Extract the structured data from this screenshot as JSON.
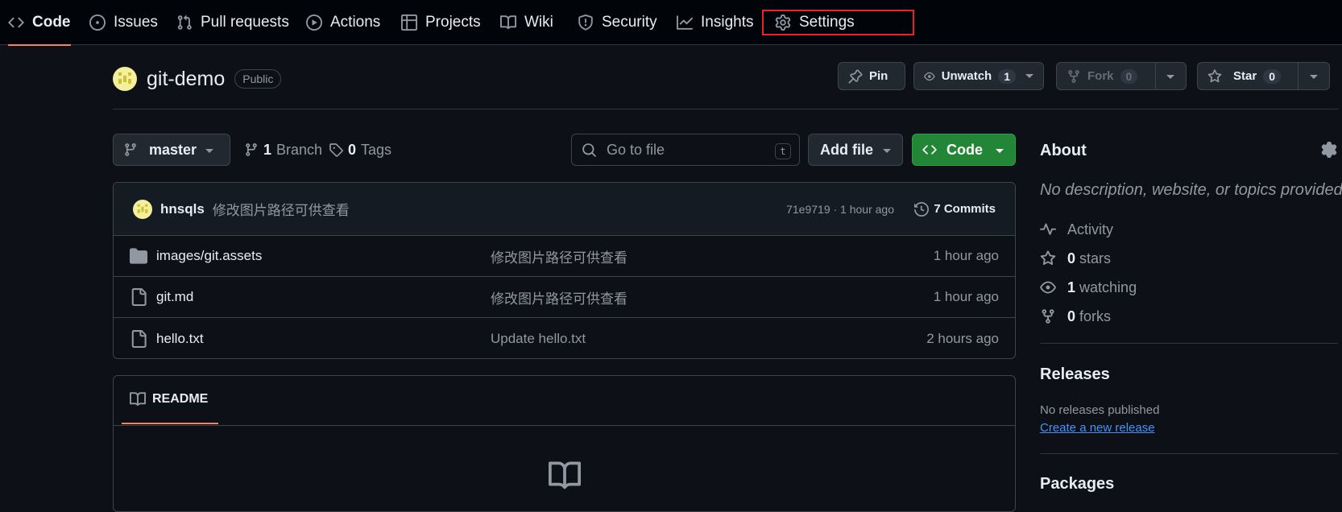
{
  "nav": {
    "tabs": [
      {
        "label": "Code",
        "icon": "code-icon"
      },
      {
        "label": "Issues",
        "icon": "issue-icon"
      },
      {
        "label": "Pull requests",
        "icon": "pull-request-icon"
      },
      {
        "label": "Actions",
        "icon": "play-icon"
      },
      {
        "label": "Projects",
        "icon": "table-icon"
      },
      {
        "label": "Wiki",
        "icon": "book-icon"
      },
      {
        "label": "Security",
        "icon": "shield-icon"
      },
      {
        "label": "Insights",
        "icon": "graph-icon"
      },
      {
        "label": "Settings",
        "icon": "gear-icon"
      }
    ],
    "active": "Code",
    "highlight_color": "#e5242a"
  },
  "repo": {
    "name": "git-demo",
    "visibility": "Public",
    "pin_label": "Pin",
    "unwatch_label": "Unwatch",
    "watch_count": "1",
    "fork_label": "Fork",
    "fork_count": "0",
    "star_label": "Star",
    "star_count": "0"
  },
  "toolbar": {
    "branch": "master",
    "branch_count": "1",
    "branch_label": "Branch",
    "tag_count": "0",
    "tag_label": "Tags",
    "goto_placeholder": "Go to file",
    "goto_shortcut": "t",
    "add_file": "Add file",
    "code_button": "Code"
  },
  "latest_commit": {
    "author": "hnsqls",
    "message": "修改图片路径可供查看",
    "hash_time": "71e9719 · 1 hour ago",
    "commits_count": "7 Commits"
  },
  "files": [
    {
      "type": "folder",
      "name": "images/git.assets",
      "message": "修改图片路径可供查看",
      "time": "1 hour ago"
    },
    {
      "type": "file",
      "name": "git.md",
      "message": "修改图片路径可供查看",
      "time": "1 hour ago"
    },
    {
      "type": "file",
      "name": "hello.txt",
      "message": "Update hello.txt",
      "time": "2 hours ago"
    }
  ],
  "readme": {
    "tab_label": "README"
  },
  "about": {
    "title": "About",
    "description": "No description, website, or topics provided.",
    "stats": [
      {
        "icon": "pulse-icon",
        "value": "",
        "label": "Activity"
      },
      {
        "icon": "star-icon",
        "value": "0",
        "label": "stars"
      },
      {
        "icon": "eye-icon",
        "value": "1",
        "label": "watching"
      },
      {
        "icon": "fork-icon",
        "value": "0",
        "label": "forks"
      }
    ]
  },
  "releases": {
    "title": "Releases",
    "text": "No releases published",
    "link": "Create a new release"
  },
  "packages": {
    "title": "Packages"
  },
  "colors": {
    "accent_underline": "#f78166",
    "code_button_bg": "#238636",
    "link": "#4493f8"
  }
}
